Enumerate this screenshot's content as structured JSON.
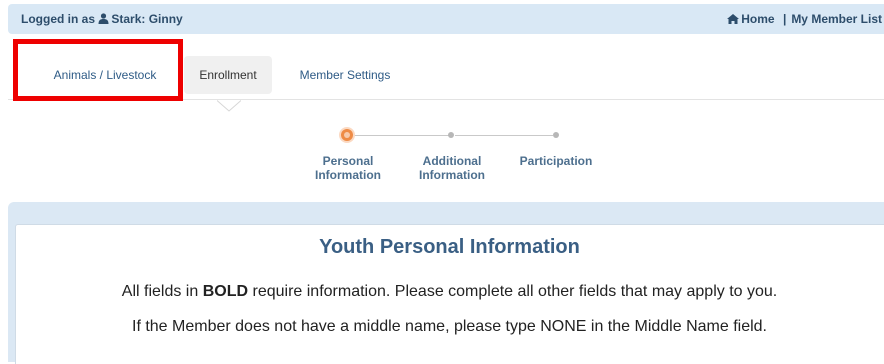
{
  "topbar": {
    "logged_in_prefix": "Logged in as",
    "user_name": "Stark: Ginny",
    "home_label": "Home",
    "separator": "|",
    "member_list_label": "My Member List"
  },
  "tabs": [
    {
      "label": "Animals / Livestock"
    },
    {
      "label": "Enrollment",
      "active": true
    },
    {
      "label": "Member Settings"
    }
  ],
  "stepper": {
    "steps": [
      {
        "line1": "Personal",
        "line2": "Information",
        "current": true
      },
      {
        "line1": "Additional",
        "line2": "Information",
        "current": false
      },
      {
        "line1": "Participation",
        "line2": "",
        "current": false
      }
    ]
  },
  "panel": {
    "title": "Youth Personal Information",
    "line1_before": "All fields in",
    "line1_bold": "BOLD",
    "line1_after": "require information. Please complete all other fields that may apply to you.",
    "line2": "If the Member does not have a middle name, please type NONE in the Middle Name field."
  },
  "colors": {
    "topbar_bg": "#d9e8f5",
    "link": "#2e5b86",
    "highlight": "#ee0000",
    "step_active": "#ee8b45",
    "panel_title": "#3a5f84"
  },
  "icons": {
    "user": "user-icon",
    "home": "home-icon"
  }
}
